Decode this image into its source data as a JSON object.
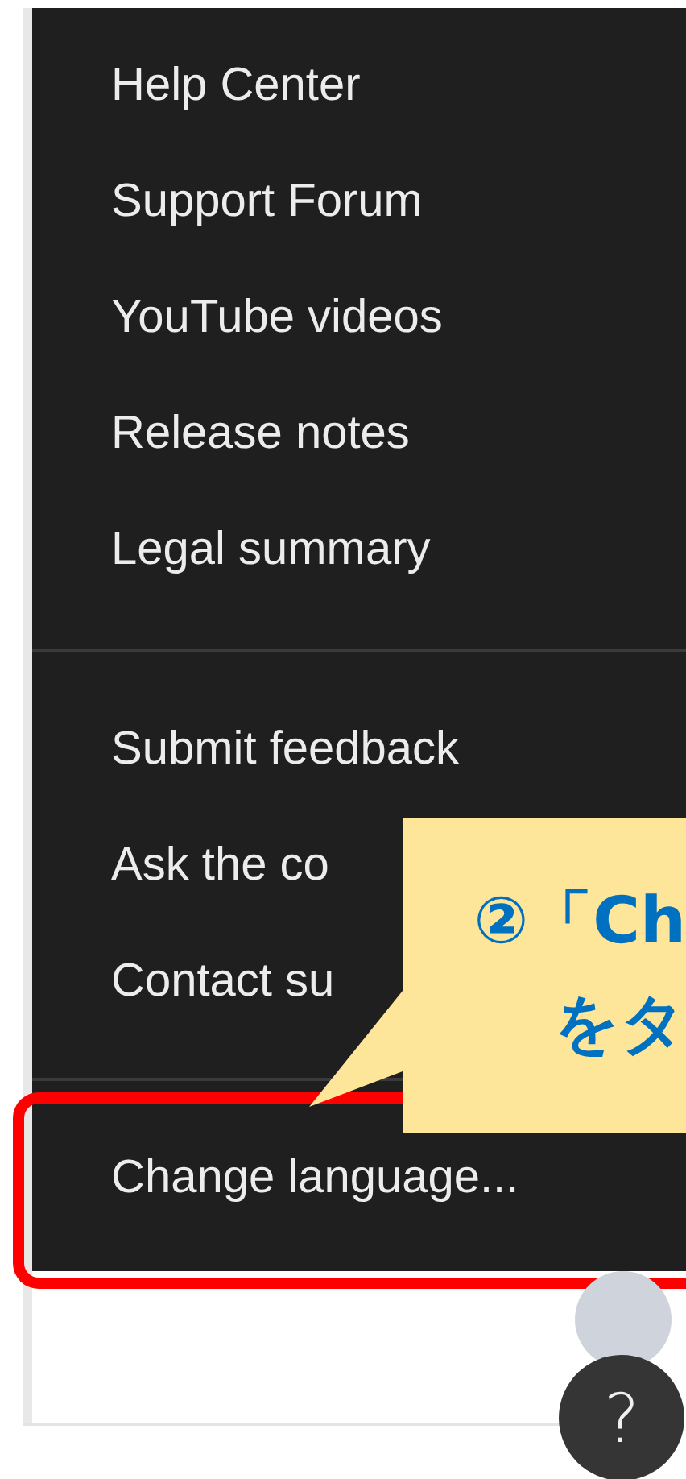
{
  "menu": {
    "groups": [
      {
        "items": [
          {
            "label": "Help Center"
          },
          {
            "label": "Support Forum"
          },
          {
            "label": "YouTube videos"
          },
          {
            "label": "Release notes"
          },
          {
            "label": "Legal summary"
          }
        ]
      },
      {
        "items": [
          {
            "label": "Submit feedback"
          },
          {
            "label": "Ask the co"
          },
          {
            "label": "Contact su"
          }
        ]
      },
      {
        "items": [
          {
            "label": "Change language..."
          }
        ]
      }
    ]
  },
  "annotation": {
    "callout_lines": [
      "②「Ch",
      "をタ"
    ]
  },
  "help_button": {
    "label": "?"
  }
}
